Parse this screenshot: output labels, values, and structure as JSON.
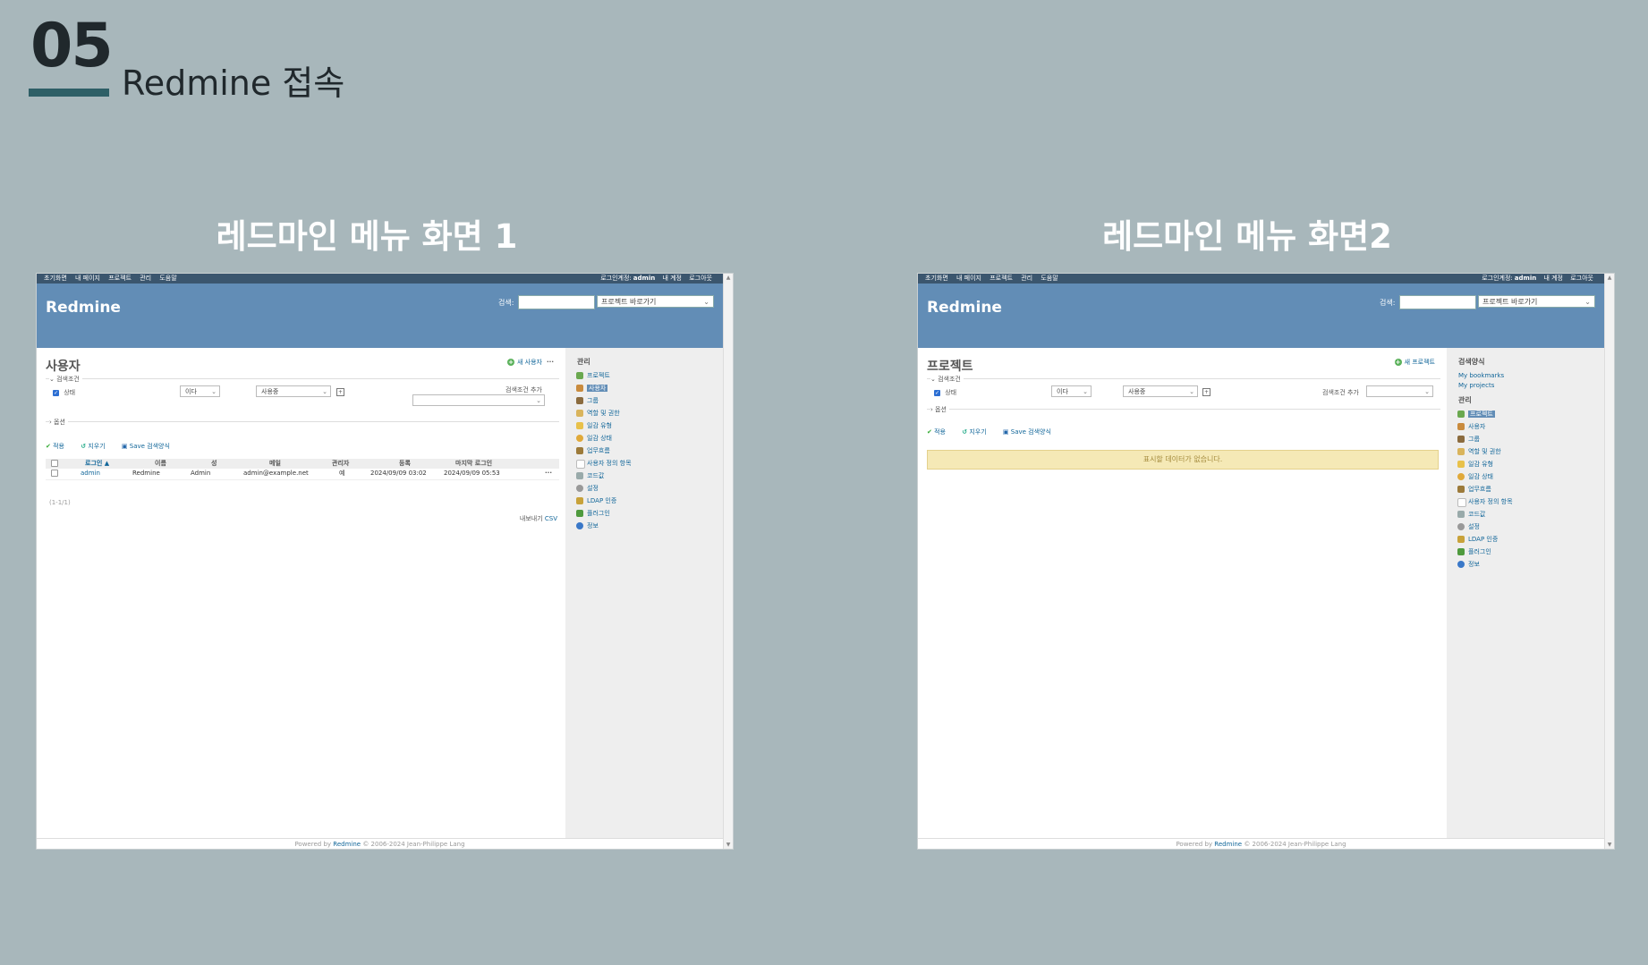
{
  "slide": {
    "number": "05",
    "title": "Redmine 접속",
    "caption_left": "레드마인 메뉴 화면 1",
    "caption_right": "레드마인 메뉴 화면2"
  },
  "common": {
    "topnav": [
      "초기화면",
      "내 페이지",
      "프로젝트",
      "관리",
      "도움말"
    ],
    "account": {
      "logged_in_label": "로그인계정:",
      "user": "admin",
      "my_account": "내 계정",
      "logout": "로그아웃"
    },
    "logo": "Redmine",
    "search_label": "검색:",
    "jump_label": "프로젝트 바로가기",
    "footer": {
      "prefix": "Powered by",
      "link": "Redmine",
      "suffix": "© 2006-2024 Jean-Philippe Lang"
    },
    "filters_label": "검색조건",
    "status_label": "상태",
    "operator": "이다",
    "status_value": "사용중",
    "add_filter_label": "검색조건 추가",
    "options_label": "옵션",
    "apply": "적용",
    "clear": "지우기",
    "save_query": "Save 검색양식"
  },
  "shot1": {
    "page_title": "사용자",
    "new_link": "새 사용자",
    "columns": [
      "로그인 ▲",
      "이름",
      "성",
      "메일",
      "관리자",
      "등록",
      "마지막 로그인"
    ],
    "rows": [
      {
        "login": "admin",
        "firstname": "Redmine",
        "lastname": "Admin",
        "mail": "admin@example.net",
        "admin": "예",
        "created": "2024/09/09 03:02",
        "last_login": "2024/09/09 05:53"
      }
    ],
    "pager": "(1-1/1)",
    "export_label": "내보내기",
    "export_csv": "CSV",
    "sidebar_title": "관리",
    "sidebar": [
      "프로젝트",
      "사용자",
      "그룹",
      "역할 및 권한",
      "일감 유형",
      "일감 상태",
      "업무흐름",
      "사용자 정의 항목",
      "코드값",
      "설정",
      "LDAP 인증",
      "플러그인",
      "정보"
    ],
    "sidebar_selected": 1
  },
  "shot2": {
    "page_title": "프로젝트",
    "new_link": "새 프로젝트",
    "no_data": "표시할 데이터가 없습니다.",
    "queries_title": "검색양식",
    "queries": [
      "My bookmarks",
      "My projects"
    ],
    "sidebar_title": "관리",
    "sidebar": [
      "프로젝트",
      "사용자",
      "그룹",
      "역할 및 권한",
      "일감 유형",
      "일감 상태",
      "업무흐름",
      "사용자 정의 항목",
      "코드값",
      "설정",
      "LDAP 인증",
      "플러그인",
      "정보"
    ],
    "sidebar_selected": 0
  },
  "colors": {
    "background": "#a8b7bb",
    "header": "#628db6",
    "topbar": "#3b566e",
    "accent_bar": "#2e5f66",
    "link": "#169"
  }
}
